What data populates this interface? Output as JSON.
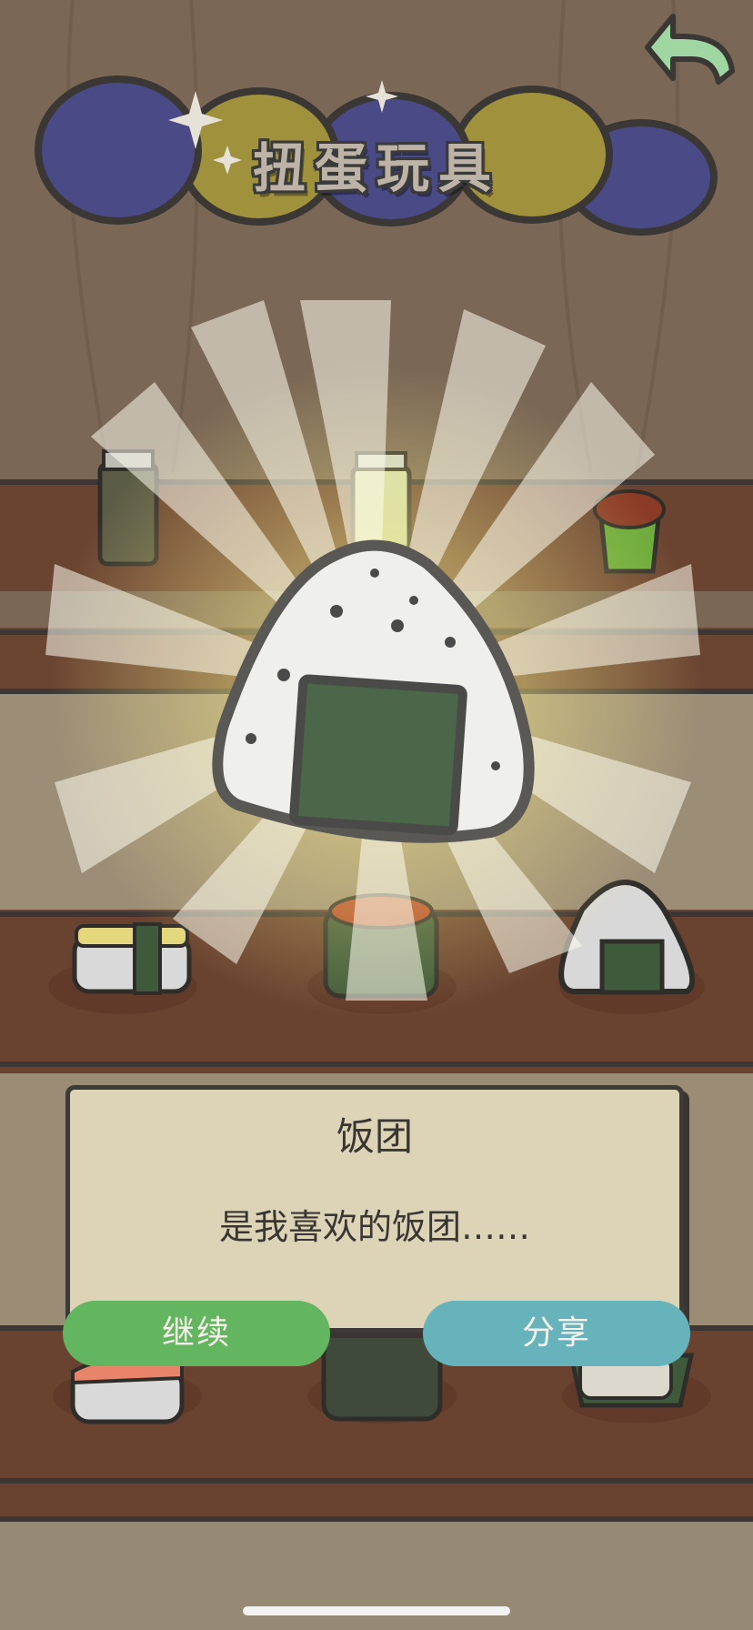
{
  "header": {
    "title": "扭蛋玩具"
  },
  "reward": {
    "item_name": "饭团",
    "description": "是我喜欢的饭团……"
  },
  "buttons": {
    "continue_label": "继续",
    "share_label": "分享"
  },
  "colors": {
    "continue": "#63b560",
    "share": "#66b3bb",
    "dialog_bg": "#ddd4b8",
    "back_arrow": "#9fd6a2"
  },
  "icons": {
    "back": "back-arrow-icon",
    "featured": "onigiri-icon"
  },
  "collection": {
    "shelf_items": [
      "jar-icon",
      "bottle-icon",
      "corn-cup-icon",
      "tamago-sushi-icon",
      "ikura-gunkan-icon",
      "onigiri-icon",
      "salmon-sushi-icon",
      "seaweed-gunkan-icon",
      "maki-roll-icon"
    ]
  }
}
